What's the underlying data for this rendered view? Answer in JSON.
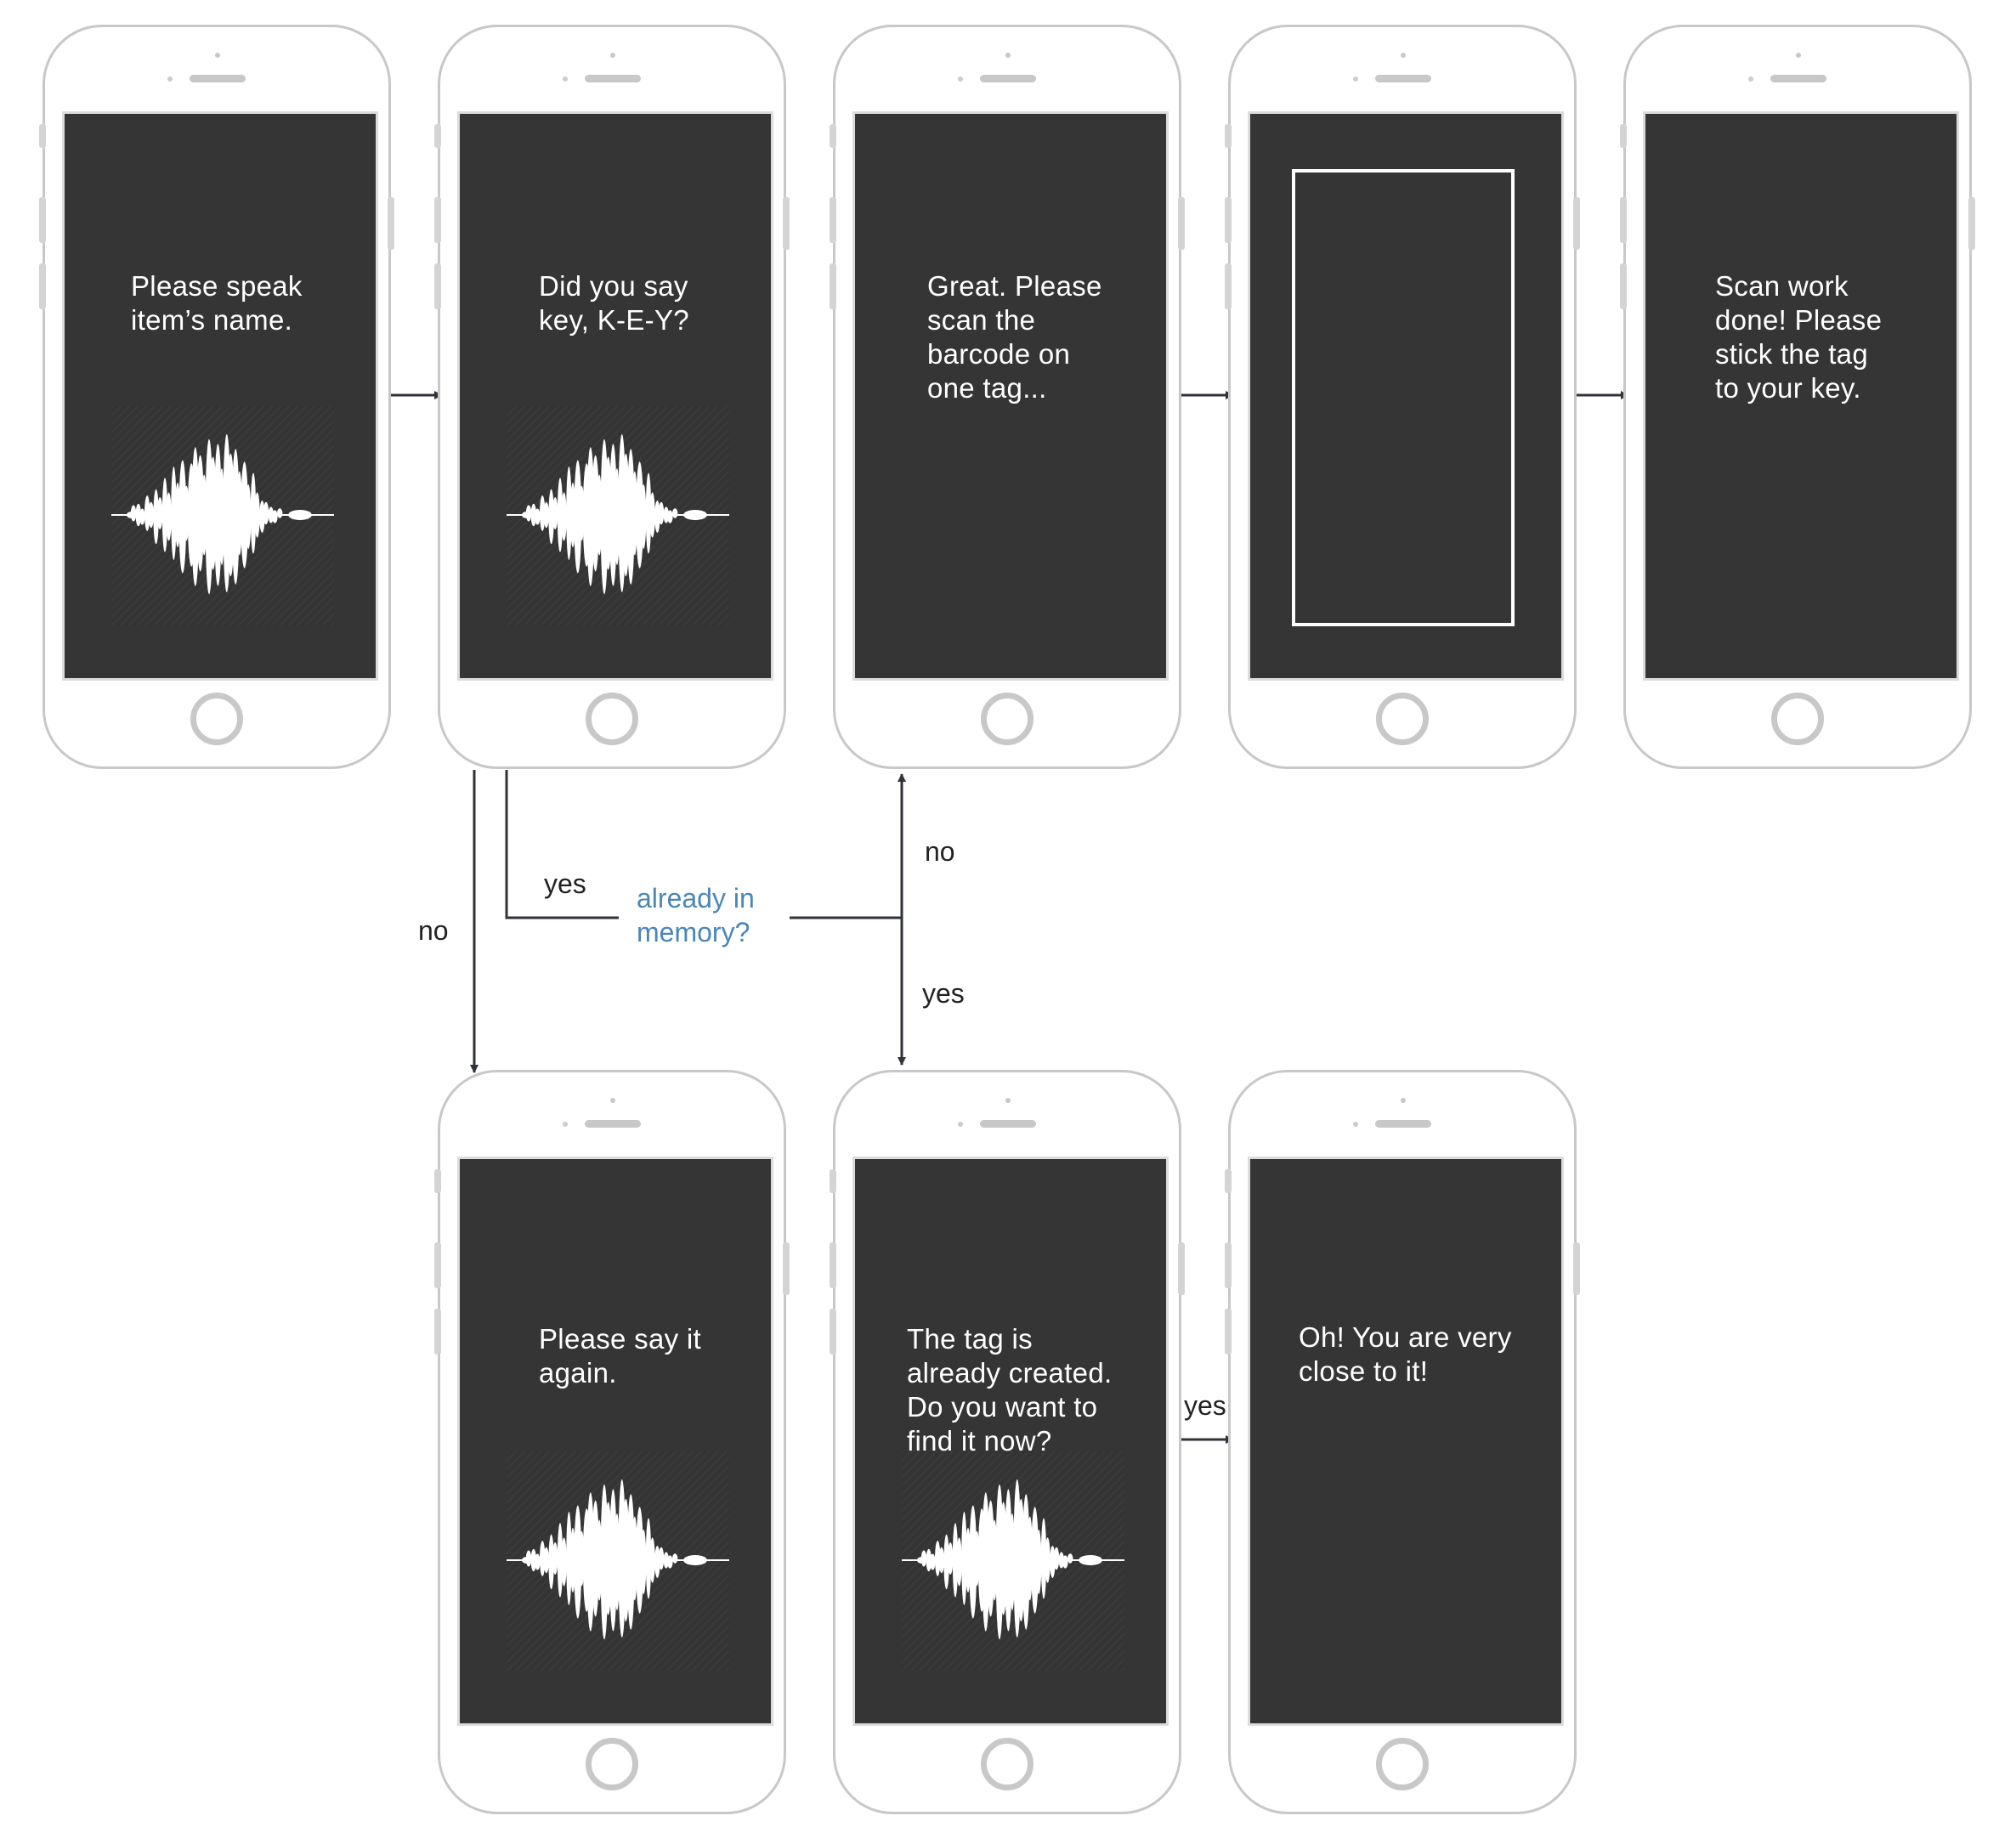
{
  "screens": {
    "speak": {
      "message": "Please speak\nitem’s name."
    },
    "confirm": {
      "message": "Did you say\nkey, K-E-Y?"
    },
    "scan_prompt": {
      "message": "Great. Please\nscan the\nbarcode on\none tag..."
    },
    "scanner": {
      "message": ""
    },
    "scan_done": {
      "message": "Scan work\ndone! Please\nstick the tag\nto your key."
    },
    "say_again": {
      "message": "Please say it\nagain."
    },
    "already_created": {
      "message": "The tag is\nalready created.\nDo you want to\nfind it now?"
    },
    "close": {
      "message": "Oh! You are very\nclose to it!"
    }
  },
  "flow": {
    "no_left": "no",
    "yes_left": "yes",
    "question": "already in\nmemory?",
    "no_up": "no",
    "yes_down": "yes",
    "yes_bottom": "yes"
  },
  "colors": {
    "screen_bg": "#353535",
    "phone_frame": "#c8c8c8",
    "question_text": "#4a86b8",
    "connector": "#2f3338"
  }
}
